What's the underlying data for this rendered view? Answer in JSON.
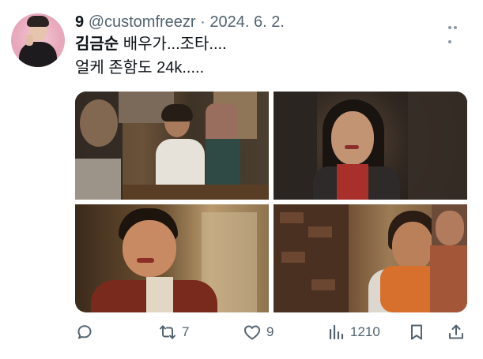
{
  "tweet": {
    "author_name": "9",
    "handle": "@customfreezr",
    "separator": "·",
    "date": "2024. 6. 2.",
    "line1_bold": "김금순",
    "line1_rest": " 배우가...조타....",
    "line2": "얼케 존함도 24k....."
  },
  "actions": {
    "reply_count": "",
    "retweet_count": "7",
    "like_count": "9",
    "views_count": "1210"
  },
  "icons": [
    "more-icon",
    "reply-icon",
    "retweet-icon",
    "like-icon",
    "views-icon",
    "bookmark-icon",
    "share-icon"
  ],
  "colors": {
    "text": "#0f1419",
    "secondary": "#536471",
    "background": "#ffffff"
  }
}
